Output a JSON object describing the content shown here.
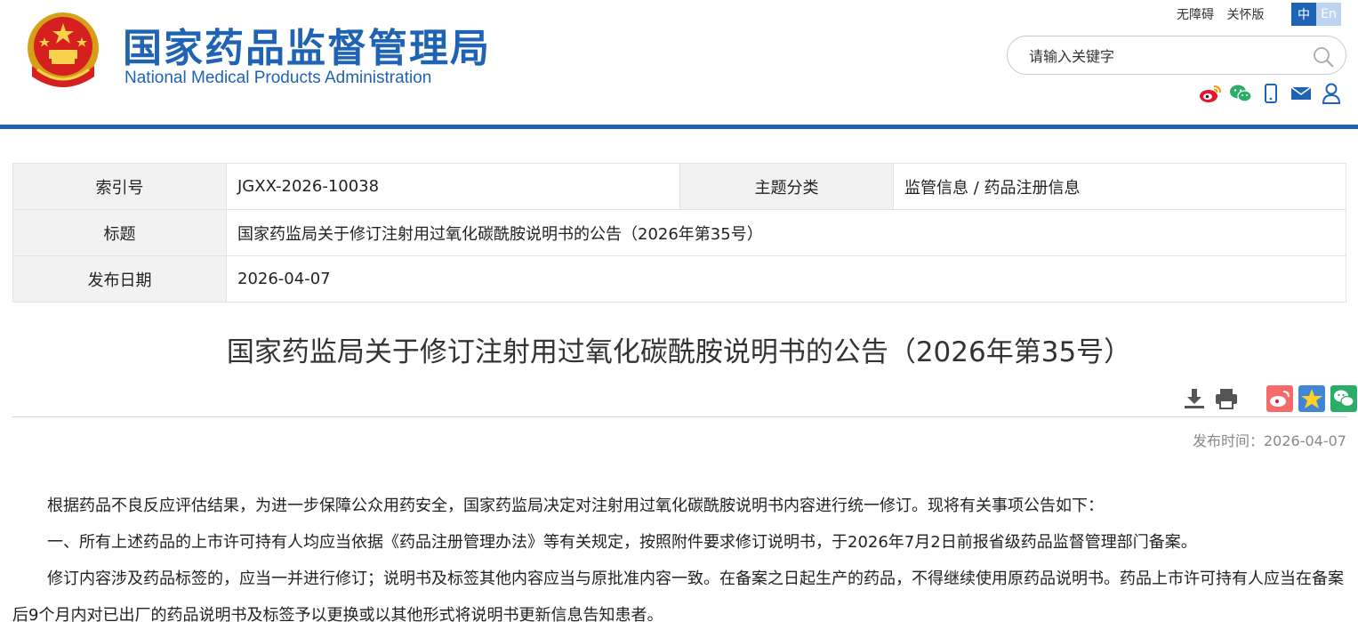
{
  "header": {
    "title_cn": "国家药品监督管理局",
    "title_en": "National Medical Products Administration",
    "accessibility": "无障碍",
    "care_mode": "关怀版",
    "lang_zh": "中",
    "lang_en": "En",
    "search_placeholder": "请输入关键字",
    "social_icons": [
      "weibo-icon",
      "wechat-icon",
      "mobile-icon",
      "mail-icon",
      "user-icon"
    ]
  },
  "info": {
    "index_label": "索引号",
    "index_value": "JGXX-2026-10038",
    "category_label": "主题分类",
    "category_value": "监管信息 / 药品注册信息",
    "title_label": "标题",
    "title_value": "国家药监局关于修订注射用过氧化碳酰胺说明书的公告（2026年第35号）",
    "date_label": "发布日期",
    "date_value": "2026-04-07"
  },
  "article": {
    "title": "国家药监局关于修订注射用过氧化碳酰胺说明书的公告（2026年第35号）",
    "publish_time": "发布时间：2026-04-07",
    "paragraphs": [
      "根据药品不良反应评估结果，为进一步保障公众用药安全，国家药监局决定对注射用过氧化碳酰胺说明书内容进行统一修订。现将有关事项公告如下：",
      "一、所有上述药品的上市许可持有人均应当依据《药品注册管理办法》等有关规定，按照附件要求修订说明书，于2026年7月2日前报省级药品监督管理部门备案。",
      "修订内容涉及药品标签的，应当一并进行修订；说明书及标签其他内容应当与原批准内容一致。在备案之日起生产的药品，不得继续使用原药品说明书。药品上市许可持有人应当在备案后9个月内对已出厂的药品说明书及标签予以更换或以其他形式将说明书更新信息告知患者。"
    ]
  },
  "colors": {
    "brand_blue": "#1f63b5",
    "weibo_red": "#e6162d",
    "wechat_green": "#2aae67"
  }
}
